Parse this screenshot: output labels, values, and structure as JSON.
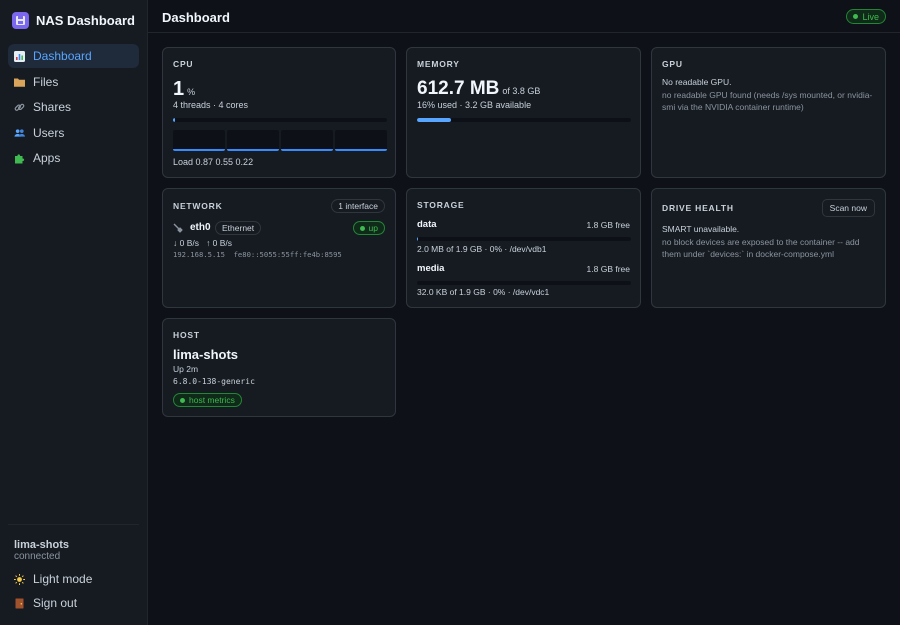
{
  "app": {
    "title": "NAS Dashboard"
  },
  "sidebar": {
    "items": [
      {
        "label": "Dashboard",
        "icon": "bar-chart-icon",
        "active": true
      },
      {
        "label": "Files",
        "icon": "folder-icon"
      },
      {
        "label": "Shares",
        "icon": "link-icon"
      },
      {
        "label": "Users",
        "icon": "users-icon"
      },
      {
        "label": "Apps",
        "icon": "puzzle-icon"
      }
    ],
    "host": "lima-shots",
    "host_status": "connected",
    "light_mode": "Light mode",
    "sign_out": "Sign out"
  },
  "header": {
    "title": "Dashboard",
    "live": "Live"
  },
  "cpu": {
    "title": "CPU",
    "value": "1",
    "unit": "%",
    "detail": "4 threads · 4 cores",
    "usage_fraction": 0.01,
    "load": "Load 0.87 0.55 0.22"
  },
  "memory": {
    "title": "MEMORY",
    "value": "612.7 MB",
    "of": "of 3.8 GB",
    "detail": "16% used · 3.2 GB available",
    "usage_fraction": 0.16
  },
  "gpu": {
    "title": "GPU",
    "line1": "No readable GPU.",
    "line2": "no readable GPU found (needs /sys mounted, or nvidia-smi via the NVIDIA container runtime)"
  },
  "network": {
    "title": "NETWORK",
    "count": "1 interface",
    "iface": "eth0",
    "type": "Ethernet",
    "status": "up",
    "rates": "↓ 0 B/s   ↑ 0 B/s",
    "addresses": "192.168.5.15  fe80::5055:55ff:fe4b:8595"
  },
  "storage": {
    "title": "STORAGE",
    "volumes": [
      {
        "name": "data",
        "free": "1.8 GB free",
        "detail": "2.0 MB of 1.9 GB · 0% · /dev/vdb1",
        "usage_fraction": 0.001
      },
      {
        "name": "media",
        "free": "1.8 GB free",
        "detail": "32.0 KB of 1.9 GB · 0% · /dev/vdc1",
        "usage_fraction": 0.0
      }
    ]
  },
  "drive_health": {
    "title": "DRIVE HEALTH",
    "scan": "Scan now",
    "line1": "SMART unavailable.",
    "line2": "no block devices are exposed to the container -- add them under `devices:` in docker-compose.yml"
  },
  "host": {
    "title": "HOST",
    "name": "lima-shots",
    "uptime": "Up 2m",
    "kernel": "6.8.0-138-generic",
    "badge": "host metrics"
  },
  "colors": {
    "accent": "#58a6ff",
    "ok": "#3fb950",
    "bg": "#0e1117",
    "card": "#161b22"
  }
}
